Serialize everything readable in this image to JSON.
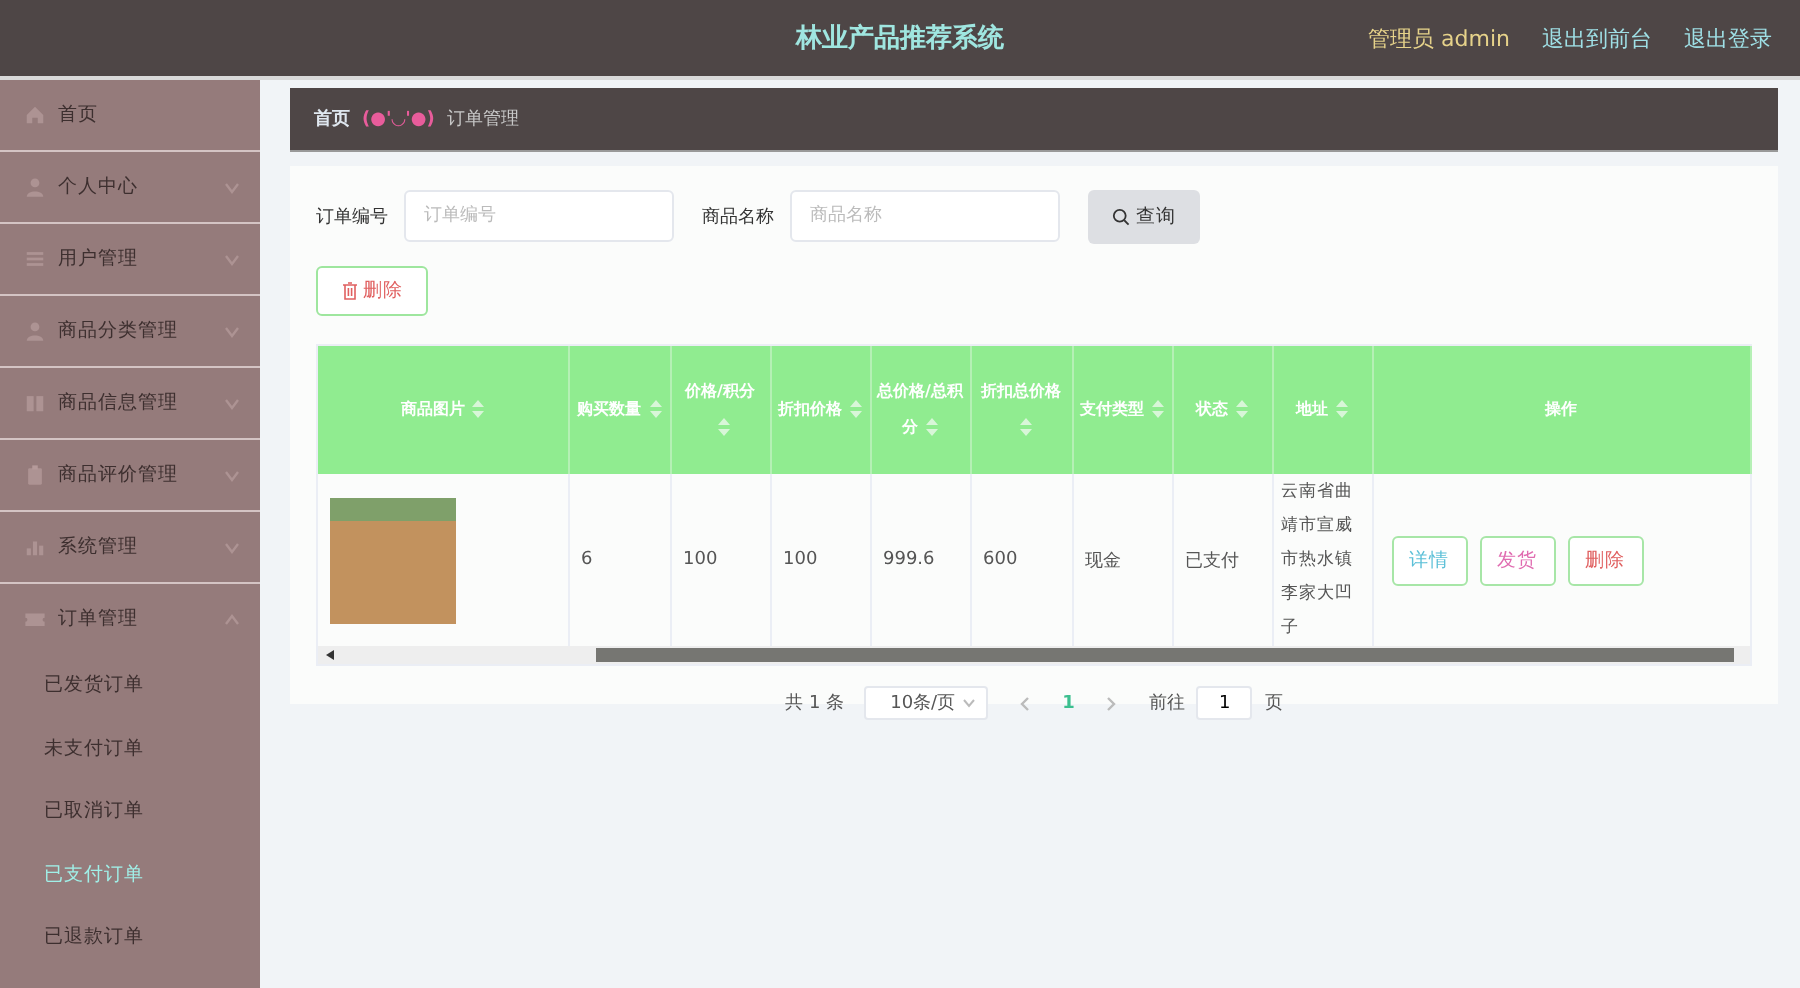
{
  "header": {
    "title": "林业产品推荐系统",
    "user": "管理员 admin",
    "links": [
      "退出到前台",
      "退出登录"
    ]
  },
  "sidebar": {
    "items": [
      {
        "label": "首页",
        "expandable": false,
        "expanded": false
      },
      {
        "label": "个人中心",
        "expandable": true,
        "expanded": false
      },
      {
        "label": "用户管理",
        "expandable": true,
        "expanded": false
      },
      {
        "label": "商品分类管理",
        "expandable": true,
        "expanded": false
      },
      {
        "label": "商品信息管理",
        "expandable": true,
        "expanded": false
      },
      {
        "label": "商品评价管理",
        "expandable": true,
        "expanded": false
      },
      {
        "label": "系统管理",
        "expandable": true,
        "expanded": false
      },
      {
        "label": "订单管理",
        "expandable": true,
        "expanded": true,
        "children": [
          {
            "label": "已发货订单",
            "selected": false
          },
          {
            "label": "未支付订单",
            "selected": false
          },
          {
            "label": "已取消订单",
            "selected": false
          },
          {
            "label": "已支付订单",
            "selected": true
          },
          {
            "label": "已退款订单",
            "selected": false
          }
        ]
      }
    ]
  },
  "breadcrumb": {
    "home": "首页",
    "separator": "(●'◡'●)",
    "current": "订单管理"
  },
  "search": {
    "fields": [
      {
        "label": "订单编号",
        "placeholder": "订单编号"
      },
      {
        "label": "商品名称",
        "placeholder": "商品名称"
      }
    ],
    "button": "查询"
  },
  "delete_button": "删除",
  "table": {
    "columns": [
      {
        "label": "商品图片",
        "sortable": true
      },
      {
        "label": "购买数量",
        "sortable": true
      },
      {
        "label": "价格/积分",
        "sortable": true
      },
      {
        "label": "折扣价格",
        "sortable": true
      },
      {
        "label": "总价格/总积分",
        "sortable": true
      },
      {
        "label": "折扣总价格",
        "sortable": true
      },
      {
        "label": "支付类型",
        "sortable": true
      },
      {
        "label": "状态",
        "sortable": true
      },
      {
        "label": "地址",
        "sortable": true
      },
      {
        "label": "操作",
        "sortable": false
      }
    ],
    "rows": [
      {
        "cells": [
          "",
          "6",
          "100",
          "100",
          "999.6",
          "600",
          "现金",
          "已支付",
          "云南省曲靖市宣威市热水镇李家大凹子"
        ],
        "actions": [
          {
            "label": "详情",
            "kind": "detail"
          },
          {
            "label": "发货",
            "kind": "ship"
          },
          {
            "label": "删除",
            "kind": "delete"
          }
        ]
      }
    ]
  },
  "pagination": {
    "total": "共 1 条",
    "page_size": "10条/页",
    "pages": [
      {
        "label": "1",
        "selected": true
      }
    ],
    "goto_label": "前往",
    "goto_value": "1",
    "page_suffix": "页"
  }
}
